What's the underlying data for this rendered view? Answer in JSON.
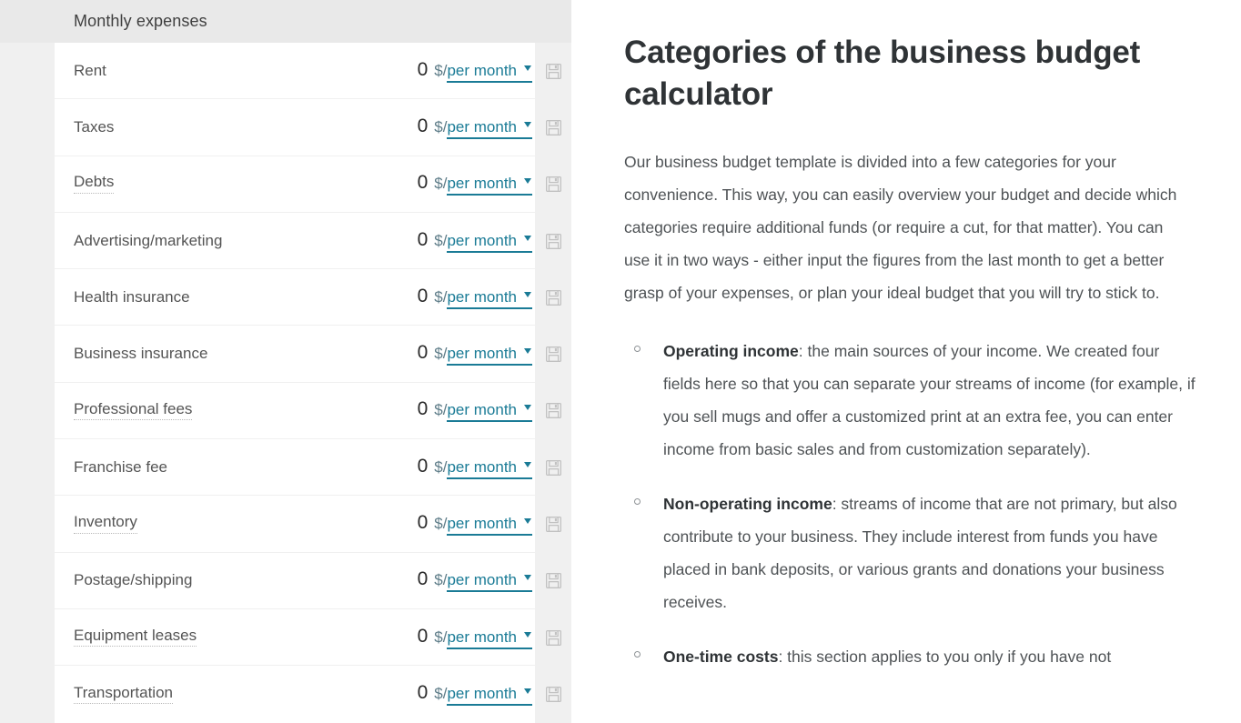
{
  "calculator": {
    "header_title": "Monthly expenses",
    "unit_currency": "$/",
    "period_label": "per month",
    "default_value": "0",
    "save_icon_name": "save-icon",
    "rows": [
      {
        "label": "Rent",
        "value": "0",
        "unit": "$/",
        "period": "per month",
        "tooltip": false
      },
      {
        "label": "Taxes",
        "value": "0",
        "unit": "$/",
        "period": "per month",
        "tooltip": false
      },
      {
        "label": "Debts",
        "value": "0",
        "unit": "$/",
        "period": "per month",
        "tooltip": true
      },
      {
        "label": "Advertising/marketing",
        "value": "0",
        "unit": "$/",
        "period": "per month",
        "tooltip": false
      },
      {
        "label": "Health insurance",
        "value": "0",
        "unit": "$/",
        "period": "per month",
        "tooltip": false
      },
      {
        "label": "Business insurance",
        "value": "0",
        "unit": "$/",
        "period": "per month",
        "tooltip": false
      },
      {
        "label": "Professional fees",
        "value": "0",
        "unit": "$/",
        "period": "per month",
        "tooltip": true
      },
      {
        "label": "Franchise fee",
        "value": "0",
        "unit": "$/",
        "period": "per month",
        "tooltip": false
      },
      {
        "label": "Inventory",
        "value": "0",
        "unit": "$/",
        "period": "per month",
        "tooltip": true
      },
      {
        "label": "Postage/shipping",
        "value": "0",
        "unit": "$/",
        "period": "per month",
        "tooltip": false
      },
      {
        "label": "Equipment leases",
        "value": "0",
        "unit": "$/",
        "period": "per month",
        "tooltip": true
      },
      {
        "label": "Transportation",
        "value": "0",
        "unit": "$/",
        "period": "per month",
        "tooltip": true
      }
    ]
  },
  "article": {
    "heading": "Categories of the business budget calculator",
    "lead": "Our business budget template is divided into a few categories for your convenience. This way, you can easily overview your budget and decide which categories require additional funds (or require a cut, for that matter). You can use it in two ways - either input the figures from the last month to get a better grasp of your expenses, or plan your ideal budget that you will try to stick to.",
    "bullets": [
      {
        "term": "Operating income",
        "text": ": the main sources of your income. We created four fields here so that you can separate your streams of income (for example, if you sell mugs and offer a customized print at an extra fee, you can enter income from basic sales and from customization separately)."
      },
      {
        "term": "Non-operating income",
        "text": ": streams of income that are not primary, but also contribute to your business. They include interest from funds you have placed in bank deposits, or various grants and donations your business receives."
      },
      {
        "term": "One-time costs",
        "text": ": this section applies to you only if you have not"
      }
    ]
  },
  "colors": {
    "accent_link": "#1a7b96",
    "header_bg": "#e9e9e9",
    "page_bg": "#f0f0f0",
    "card_bg": "#ffffff",
    "heading_text": "#2f3336",
    "body_text": "#4e5255",
    "row_label": "#545454"
  }
}
